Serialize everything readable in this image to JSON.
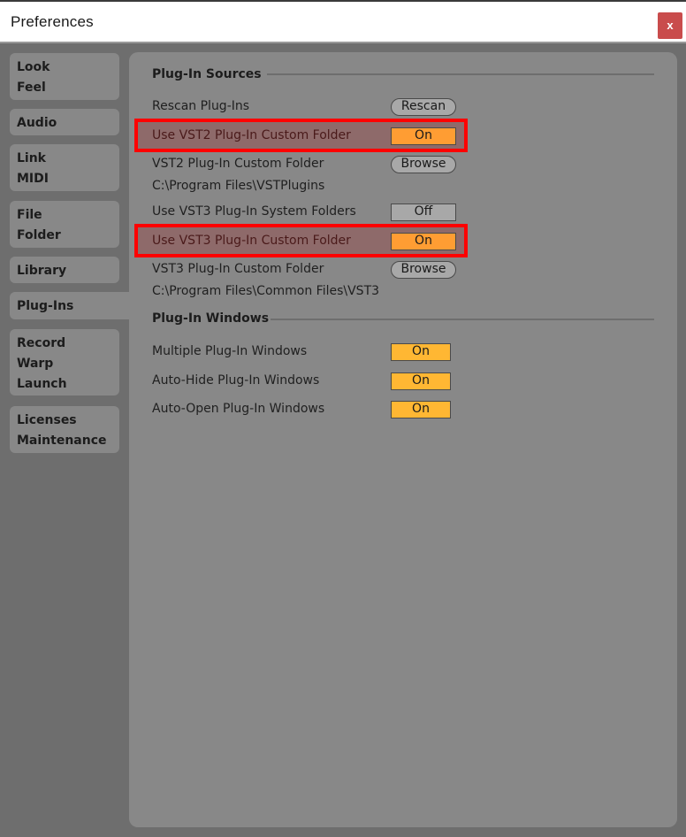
{
  "window": {
    "title": "Preferences",
    "close_label": "x"
  },
  "sidebar": {
    "tabs": [
      {
        "lines": [
          "Look",
          "Feel"
        ]
      },
      {
        "lines": [
          "Audio"
        ]
      },
      {
        "lines": [
          "Link",
          "MIDI"
        ]
      },
      {
        "lines": [
          "File",
          "Folder"
        ]
      },
      {
        "lines": [
          "Library"
        ]
      },
      {
        "lines": [
          "Plug-Ins"
        ],
        "selected": true
      },
      {
        "lines": [
          "Record",
          "Warp",
          "Launch"
        ]
      },
      {
        "lines": [
          "Licenses",
          "Maintenance"
        ]
      }
    ]
  },
  "plugin_sources": {
    "header": "Plug-In Sources",
    "rescan": {
      "label": "Rescan Plug-Ins",
      "button": "Rescan"
    },
    "vst2_use_custom": {
      "label": "Use VST2 Plug-In Custom Folder",
      "value": "On"
    },
    "vst2_custom_folder": {
      "label": "VST2 Plug-In Custom Folder",
      "button": "Browse",
      "path": "C:\\Program Files\\VSTPlugins"
    },
    "vst3_system": {
      "label": "Use VST3 Plug-In System Folders",
      "value": "Off"
    },
    "vst3_use_custom": {
      "label": "Use VST3 Plug-In Custom Folder",
      "value": "On"
    },
    "vst3_custom_folder": {
      "label": "VST3 Plug-In Custom Folder",
      "button": "Browse",
      "path": "C:\\Program Files\\Common Files\\VST3"
    }
  },
  "plugin_windows": {
    "header": "Plug-In Windows",
    "multiple": {
      "label": "Multiple Plug-In Windows",
      "value": "On"
    },
    "auto_hide": {
      "label": "Auto-Hide Plug-In Windows",
      "value": "On"
    },
    "auto_open": {
      "label": "Auto-Open Plug-In Windows",
      "value": "On"
    }
  },
  "colors": {
    "toggle_on": "#ff9d33",
    "toggle_on_alt": "#ffb733",
    "highlight": "#ff0000",
    "close": "#c94c4c"
  }
}
